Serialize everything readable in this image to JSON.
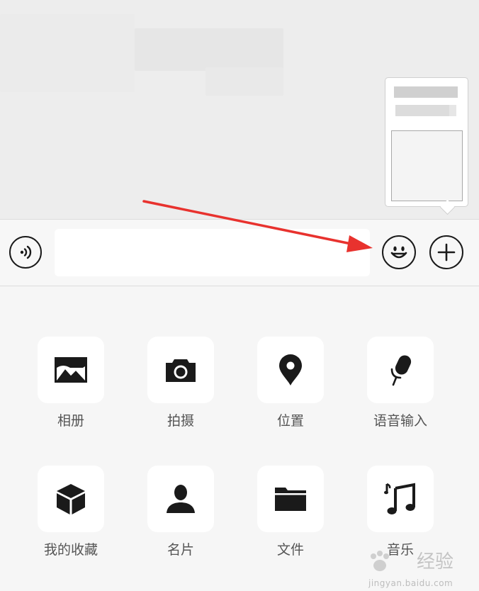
{
  "composer": {
    "input_value": "",
    "input_placeholder": ""
  },
  "icons": {
    "voice": "voice-wave-icon",
    "emoji": "smiley-icon",
    "more": "plus-icon",
    "arrow": "red-arrow-annotation"
  },
  "panel": {
    "items": [
      {
        "label": "相册",
        "icon": "photo-album-icon"
      },
      {
        "label": "拍摄",
        "icon": "camera-icon"
      },
      {
        "label": "位置",
        "icon": "location-pin-icon"
      },
      {
        "label": "语音输入",
        "icon": "microphone-icon"
      },
      {
        "label": "我的收藏",
        "icon": "cube-icon"
      },
      {
        "label": "名片",
        "icon": "contact-card-icon"
      },
      {
        "label": "文件",
        "icon": "folder-icon"
      },
      {
        "label": "音乐",
        "icon": "music-note-icon"
      }
    ]
  },
  "watermark": {
    "text": "经验",
    "url": "jingyan.baidu.com"
  },
  "colors": {
    "annotation": "#e8322e",
    "icon": "#1a1a1a",
    "label": "#555555"
  }
}
